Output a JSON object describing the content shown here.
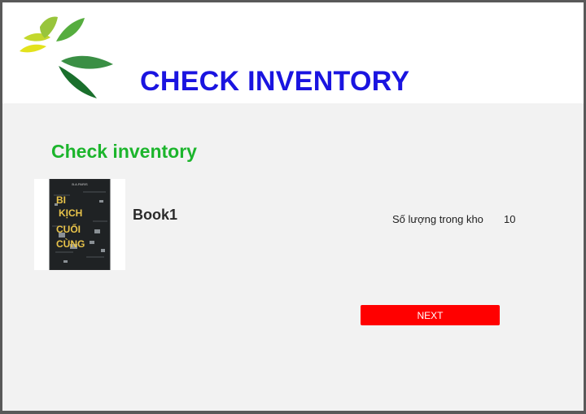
{
  "header": {
    "title": "CHECK INVENTORY"
  },
  "main": {
    "section_title": "Check inventory",
    "book": {
      "name": "Book1",
      "cover_text": [
        "BI",
        "KỊCH",
        "CUỐI",
        "CÙNG"
      ],
      "stock_label": "Số lượng trong kho",
      "stock_value": "10"
    },
    "next_label": "NEXT"
  },
  "colors": {
    "title": "#1a14e0",
    "section_title": "#1cb52c",
    "next_button": "#ff0000",
    "cover_text": "#e8c34a"
  },
  "icons": {
    "logo": "leaf-logo-icon"
  }
}
